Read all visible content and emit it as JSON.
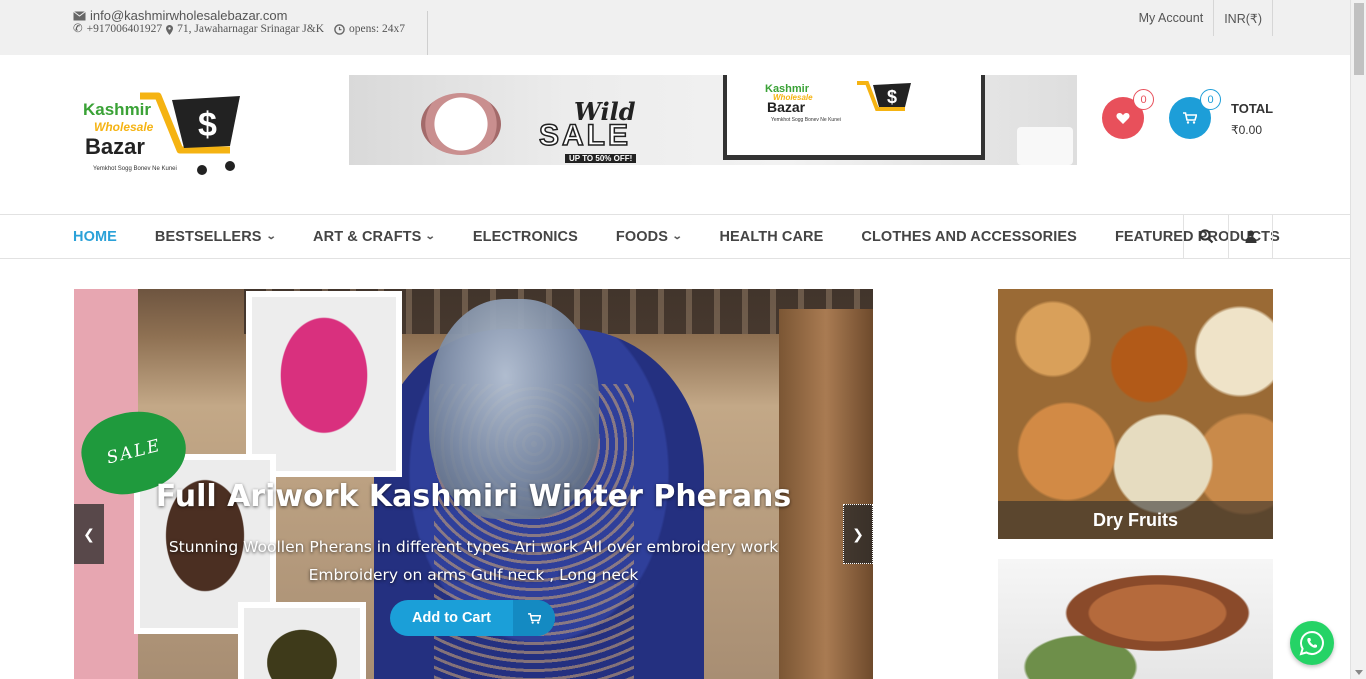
{
  "topbar": {
    "email": "info@kashmirwholesalebazar.com",
    "phone": "+917006401927",
    "address": "71, Jawaharnagar Srinagar J&K",
    "hours": "opens: 24x7",
    "my_account": "My Account",
    "currency": "INR(₹)"
  },
  "logo": {
    "line1": "Kashmir",
    "line2": "Wholesale",
    "line3": "Bazar",
    "tagline": "Yemkhot Sogg Bonev Ne Kunei"
  },
  "banner": {
    "headline1": "Wild",
    "headline2": "SALE",
    "subline": "UP TO 50% OFF!",
    "logo_line1": "Kashmir",
    "logo_line2": "Wholesale",
    "logo_line3": "Bazar",
    "logo_tagline": "Yemkhot Sogg Bonev Ne Kunei"
  },
  "header": {
    "wishlist_count": "0",
    "cart_count": "0",
    "total_label": "TOTAL",
    "total_amount": "₹0.00"
  },
  "nav": {
    "items": [
      {
        "label": "HOME",
        "active": true,
        "dropdown": false
      },
      {
        "label": "BESTSELLERS",
        "active": false,
        "dropdown": true
      },
      {
        "label": "ART & CRAFTS",
        "active": false,
        "dropdown": true
      },
      {
        "label": "ELECTRONICS",
        "active": false,
        "dropdown": false
      },
      {
        "label": "FOODS",
        "active": false,
        "dropdown": true
      },
      {
        "label": "HEALTH CARE",
        "active": false,
        "dropdown": false
      },
      {
        "label": "CLOTHES AND ACCESSORIES",
        "active": false,
        "dropdown": false
      },
      {
        "label": "FEATURED PRODUCTS",
        "active": false,
        "dropdown": false
      }
    ]
  },
  "slider": {
    "sale_badge": "SALE",
    "title": "Full Ariwork Kashmiri Winter Pherans",
    "subtitle_line1": "Stunning Woollen Pherans in different types Ari work All over embroidery work",
    "subtitle_line2": "Embroidery on arms Gulf neck , Long neck",
    "button": "Add to Cart"
  },
  "side_tiles": {
    "tile1_label": "Dry Fruits"
  },
  "colors": {
    "accent_blue": "#1d9ed8",
    "wishlist_red": "#e8505b",
    "nav_active": "#2aa1d8",
    "whatsapp_green": "#25d366"
  }
}
